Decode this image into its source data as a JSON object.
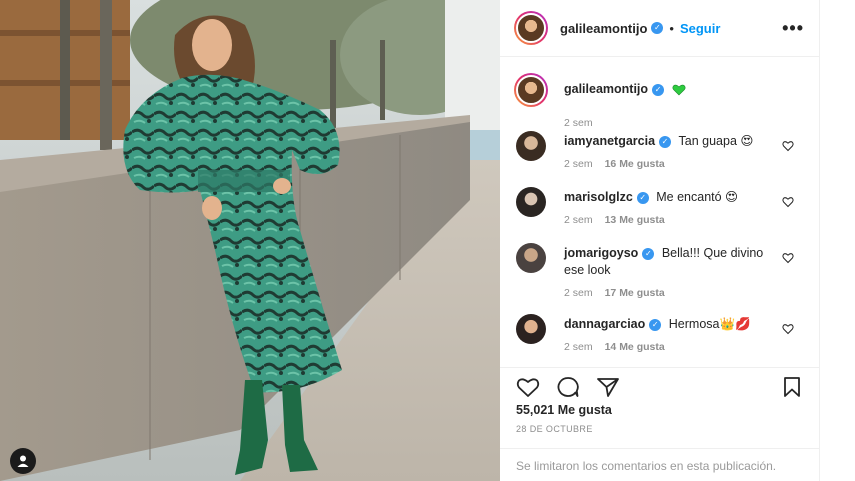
{
  "post": {
    "author": "galileamontijo",
    "follow_label": "Seguir",
    "separator": "•",
    "more_label": "•••",
    "caption_emoji_color": "#2ecc40",
    "caption_time": "2 sem",
    "likes_label": "55,021 Me gusta",
    "date_label": "28 DE OCTUBRE",
    "comments_limited": "Se limitaron los comentarios en esta publicación."
  },
  "comments": [
    {
      "user": "iamyanetgarcia",
      "text": "Tan guapa 😍",
      "time": "2 sem",
      "likes": "16 Me gusta",
      "verified": true
    },
    {
      "user": "marisolglzc",
      "text": "Me encantó 😍",
      "time": "2 sem",
      "likes": "13 Me gusta",
      "verified": true
    },
    {
      "user": "jomarigoyso",
      "text": "Bella!!! Que divino ese look",
      "time": "2 sem",
      "likes": "17 Me gusta",
      "verified": true
    },
    {
      "user": "dannagarciao",
      "text": "Hermosa👑💋",
      "time": "2 sem",
      "likes": "14 Me gusta",
      "verified": true
    }
  ],
  "colors": {
    "accent": "#0095f6",
    "verified": "#3897f0",
    "muted": "#8e8e8e"
  },
  "icons": [
    "heart-icon",
    "comment-icon",
    "share-icon",
    "bookmark-icon",
    "more-options-icon",
    "user-tag-icon"
  ]
}
